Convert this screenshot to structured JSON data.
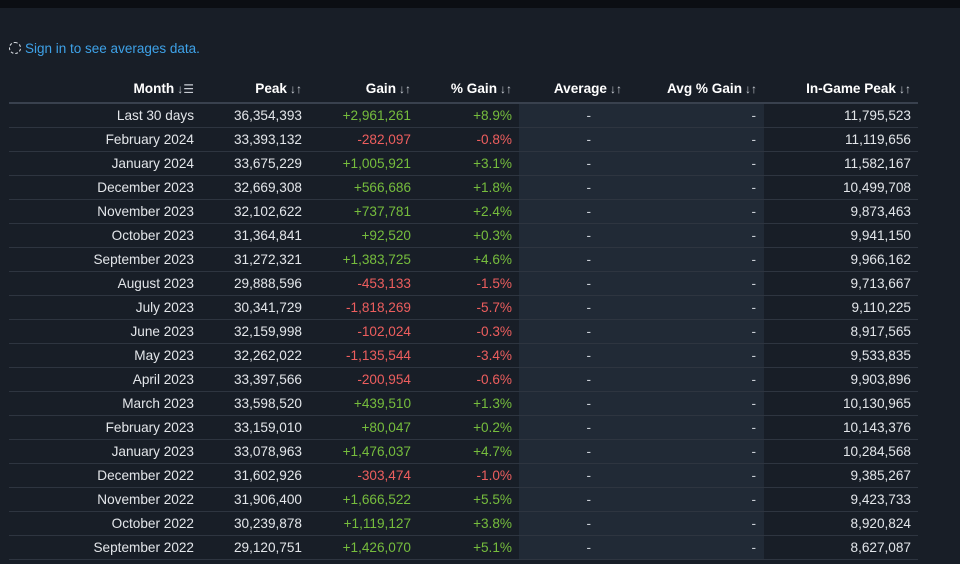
{
  "signin_text": "Sign in to see averages data.",
  "columns": [
    "Month",
    "Peak",
    "Gain",
    "% Gain",
    "Average",
    "Avg % Gain",
    "In-Game Peak"
  ],
  "sort_icons": {
    "month": "sort-descending-icon",
    "other": "sort-toggle-icon",
    "month_glyph": "↓☰",
    "other_glyph": "↓↑"
  },
  "colors": {
    "positive": "#76bd3d",
    "negative": "#ed5e5e",
    "link": "#3ea2e8"
  },
  "rows": [
    {
      "month": "Last 30 days",
      "peak": "36,354,393",
      "gain": "+2,961,261",
      "pct_gain": "+8.9%",
      "average": "-",
      "avg_pct_gain": "-",
      "in_game_peak": "11,795,523"
    },
    {
      "month": "February 2024",
      "peak": "33,393,132",
      "gain": "-282,097",
      "pct_gain": "-0.8%",
      "average": "-",
      "avg_pct_gain": "-",
      "in_game_peak": "11,119,656"
    },
    {
      "month": "January 2024",
      "peak": "33,675,229",
      "gain": "+1,005,921",
      "pct_gain": "+3.1%",
      "average": "-",
      "avg_pct_gain": "-",
      "in_game_peak": "11,582,167"
    },
    {
      "month": "December 2023",
      "peak": "32,669,308",
      "gain": "+566,686",
      "pct_gain": "+1.8%",
      "average": "-",
      "avg_pct_gain": "-",
      "in_game_peak": "10,499,708"
    },
    {
      "month": "November 2023",
      "peak": "32,102,622",
      "gain": "+737,781",
      "pct_gain": "+2.4%",
      "average": "-",
      "avg_pct_gain": "-",
      "in_game_peak": "9,873,463"
    },
    {
      "month": "October 2023",
      "peak": "31,364,841",
      "gain": "+92,520",
      "pct_gain": "+0.3%",
      "average": "-",
      "avg_pct_gain": "-",
      "in_game_peak": "9,941,150"
    },
    {
      "month": "September 2023",
      "peak": "31,272,321",
      "gain": "+1,383,725",
      "pct_gain": "+4.6%",
      "average": "-",
      "avg_pct_gain": "-",
      "in_game_peak": "9,966,162"
    },
    {
      "month": "August 2023",
      "peak": "29,888,596",
      "gain": "-453,133",
      "pct_gain": "-1.5%",
      "average": "-",
      "avg_pct_gain": "-",
      "in_game_peak": "9,713,667"
    },
    {
      "month": "July 2023",
      "peak": "30,341,729",
      "gain": "-1,818,269",
      "pct_gain": "-5.7%",
      "average": "-",
      "avg_pct_gain": "-",
      "in_game_peak": "9,110,225"
    },
    {
      "month": "June 2023",
      "peak": "32,159,998",
      "gain": "-102,024",
      "pct_gain": "-0.3%",
      "average": "-",
      "avg_pct_gain": "-",
      "in_game_peak": "8,917,565"
    },
    {
      "month": "May 2023",
      "peak": "32,262,022",
      "gain": "-1,135,544",
      "pct_gain": "-3.4%",
      "average": "-",
      "avg_pct_gain": "-",
      "in_game_peak": "9,533,835"
    },
    {
      "month": "April 2023",
      "peak": "33,397,566",
      "gain": "-200,954",
      "pct_gain": "-0.6%",
      "average": "-",
      "avg_pct_gain": "-",
      "in_game_peak": "9,903,896"
    },
    {
      "month": "March 2023",
      "peak": "33,598,520",
      "gain": "+439,510",
      "pct_gain": "+1.3%",
      "average": "-",
      "avg_pct_gain": "-",
      "in_game_peak": "10,130,965"
    },
    {
      "month": "February 2023",
      "peak": "33,159,010",
      "gain": "+80,047",
      "pct_gain": "+0.2%",
      "average": "-",
      "avg_pct_gain": "-",
      "in_game_peak": "10,143,376"
    },
    {
      "month": "January 2023",
      "peak": "33,078,963",
      "gain": "+1,476,037",
      "pct_gain": "+4.7%",
      "average": "-",
      "avg_pct_gain": "-",
      "in_game_peak": "10,284,568"
    },
    {
      "month": "December 2022",
      "peak": "31,602,926",
      "gain": "-303,474",
      "pct_gain": "-1.0%",
      "average": "-",
      "avg_pct_gain": "-",
      "in_game_peak": "9,385,267"
    },
    {
      "month": "November 2022",
      "peak": "31,906,400",
      "gain": "+1,666,522",
      "pct_gain": "+5.5%",
      "average": "-",
      "avg_pct_gain": "-",
      "in_game_peak": "9,423,733"
    },
    {
      "month": "October 2022",
      "peak": "30,239,878",
      "gain": "+1,119,127",
      "pct_gain": "+3.8%",
      "average": "-",
      "avg_pct_gain": "-",
      "in_game_peak": "8,920,824"
    },
    {
      "month": "September 2022",
      "peak": "29,120,751",
      "gain": "+1,426,070",
      "pct_gain": "+5.1%",
      "average": "-",
      "avg_pct_gain": "-",
      "in_game_peak": "8,627,087"
    }
  ]
}
